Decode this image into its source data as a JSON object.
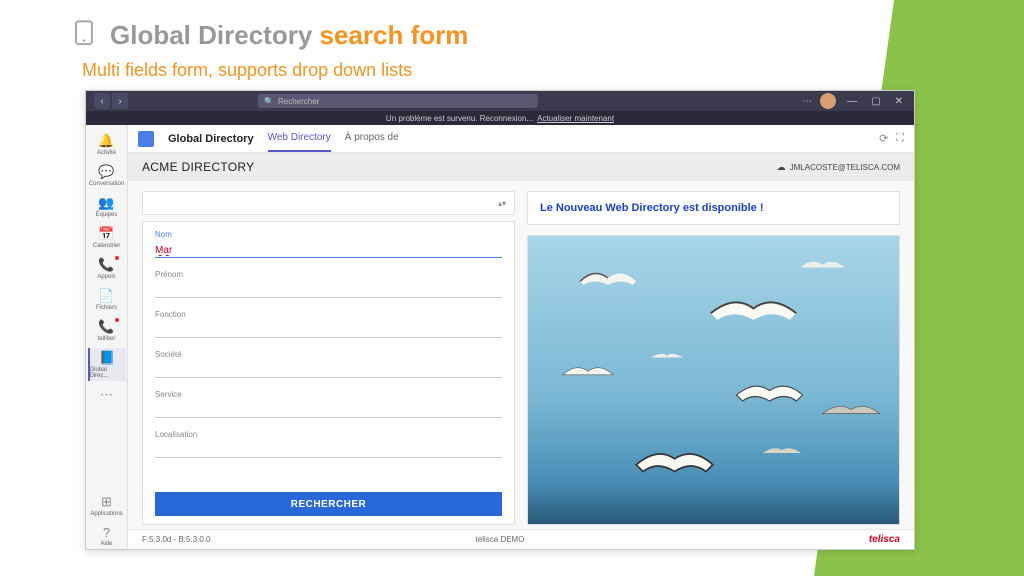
{
  "slide": {
    "title_prefix": "Global Directory ",
    "title_accent": "search form",
    "subtitle": "Multi fields form, supports drop down lists"
  },
  "titlebar": {
    "search_placeholder": "Rechercher"
  },
  "status": {
    "msg": "Un problème est survenu. Reconnexion...",
    "link": "Actualiser maintenant"
  },
  "rail": {
    "items": [
      {
        "label": "Activité",
        "icon": "🔔"
      },
      {
        "label": "Conversation",
        "icon": "💬"
      },
      {
        "label": "Équipes",
        "icon": "👥"
      },
      {
        "label": "Calendrier",
        "icon": "📅"
      },
      {
        "label": "Appels",
        "icon": "📞"
      },
      {
        "label": "Fichiers",
        "icon": "📄"
      },
      {
        "label": "telliber",
        "icon": "📞"
      },
      {
        "label": "Global Direc...",
        "icon": "📘"
      },
      {
        "label": "",
        "icon": "⋯"
      }
    ],
    "bottom": [
      {
        "label": "Applications",
        "icon": "⊞"
      },
      {
        "label": "Aide",
        "icon": "?"
      }
    ]
  },
  "tabs": {
    "app_name": "Global Directory",
    "items": [
      "Web Directory",
      "À propos de"
    ]
  },
  "dir": {
    "title": "ACME DIRECTORY",
    "user": "JMLACOSTE@TELISCA.COM"
  },
  "form": {
    "fields": [
      {
        "label": "Nom",
        "value": "Mar"
      },
      {
        "label": "Prénom",
        "value": ""
      },
      {
        "label": "Fonction",
        "value": ""
      },
      {
        "label": "Société",
        "value": ""
      },
      {
        "label": "Service",
        "value": ""
      },
      {
        "label": "Localisation",
        "value": ""
      }
    ],
    "submit": "RECHERCHER"
  },
  "announcement": "Le Nouveau Web Directory est disponible !",
  "footer": {
    "version": "F:5.3.0d - B:5.3.0.0",
    "center": "telisca DEMO",
    "logo": "telisca"
  }
}
